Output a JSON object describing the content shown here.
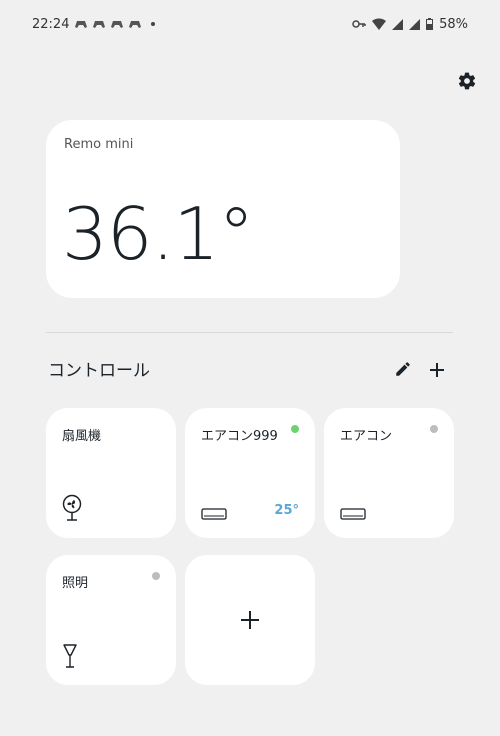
{
  "status_bar": {
    "time": "22:24",
    "battery": "58%"
  },
  "sensor": {
    "name": "Remo mini",
    "temperature": "36.1°"
  },
  "section": {
    "title": "コントロール"
  },
  "tiles": [
    {
      "label": "扇風機",
      "icon": "fan-icon"
    },
    {
      "label": "エアコン999",
      "status_color": "#6dd36d",
      "value": "25°",
      "value_color": "#5aa6d6",
      "icon": "air-conditioner-icon"
    },
    {
      "label": "エアコン",
      "status_color": "#bdbdbd",
      "icon": "air-conditioner-icon"
    },
    {
      "label": "照明",
      "status_color": "#bdbdbd",
      "icon": "lamp-icon"
    }
  ],
  "colors": {
    "background": "#f0f0f0",
    "card": "#ffffff",
    "text": "#1b2228"
  }
}
